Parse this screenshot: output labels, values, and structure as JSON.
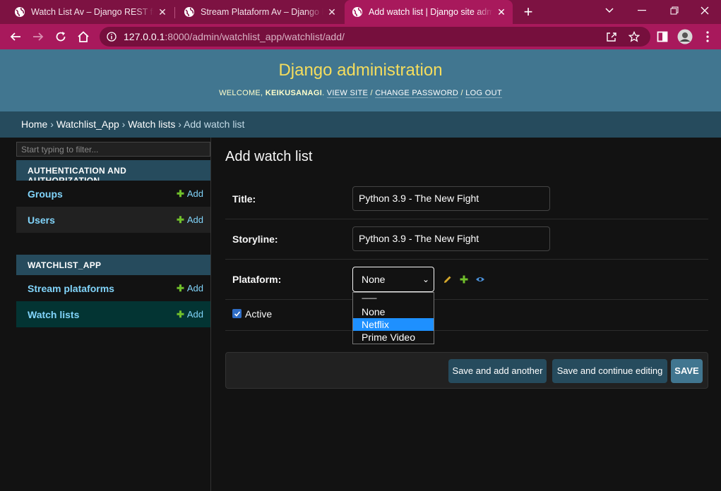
{
  "browser": {
    "tabs": [
      {
        "title": "Watch List Av – Django REST framework",
        "active": false
      },
      {
        "title": "Stream Plataform Av – Django REST framework",
        "active": false
      },
      {
        "title": "Add watch list | Django site admin",
        "active": true
      }
    ],
    "url_host": "127.0.0.1",
    "url_path": ":8000/admin/watchlist_app/watchlist/add/",
    "colors": {
      "tabbar": "#7d1242",
      "toolbar": "#a8195c"
    }
  },
  "header": {
    "brand": "Django administration",
    "welcome": "Welcome,",
    "username": "keikusanagi",
    "view_site": "View site",
    "change_password": "Change password",
    "log_out": "Log out"
  },
  "breadcrumbs": {
    "home": "Home",
    "app": "Watchlist_App",
    "model": "Watch lists",
    "current": "Add watch list"
  },
  "sidebar": {
    "filter_placeholder": "Start typing to filter...",
    "modules": [
      {
        "caption": "Authentication and Authorization",
        "items": [
          {
            "name": "Groups",
            "add": "Add"
          },
          {
            "name": "Users",
            "add": "Add"
          }
        ]
      },
      {
        "caption": "Watchlist_App",
        "items": [
          {
            "name": "Stream plataforms",
            "add": "Add"
          },
          {
            "name": "Watch lists",
            "add": "Add",
            "current": true
          }
        ]
      }
    ]
  },
  "form": {
    "title": "Add watch list",
    "fields": {
      "title": {
        "label": "Title:",
        "value": "Python 3.9 - The New Fight"
      },
      "storyline": {
        "label": "Storyline:",
        "value": "Python 3.9 - The New Fight"
      },
      "plataform": {
        "label": "Plataform:",
        "selected": "None",
        "options": [
          "---------",
          "None",
          "Netflix",
          "Prime Video"
        ],
        "highlighted": "Netflix"
      },
      "active": {
        "label": "Active",
        "checked": true
      }
    },
    "buttons": {
      "save_add_another": "Save and add another",
      "save_continue": "Save and continue editing",
      "save": "SAVE"
    }
  },
  "icons": [
    "globe-icon",
    "close-icon",
    "new-tab-icon",
    "back-icon",
    "forward-icon",
    "reload-icon",
    "home-icon",
    "info-icon",
    "share-icon",
    "star-icon",
    "sidepanel-icon",
    "profile-avatar",
    "menu-icon",
    "pencil-icon",
    "plus-icon",
    "eye-icon",
    "check-icon"
  ]
}
